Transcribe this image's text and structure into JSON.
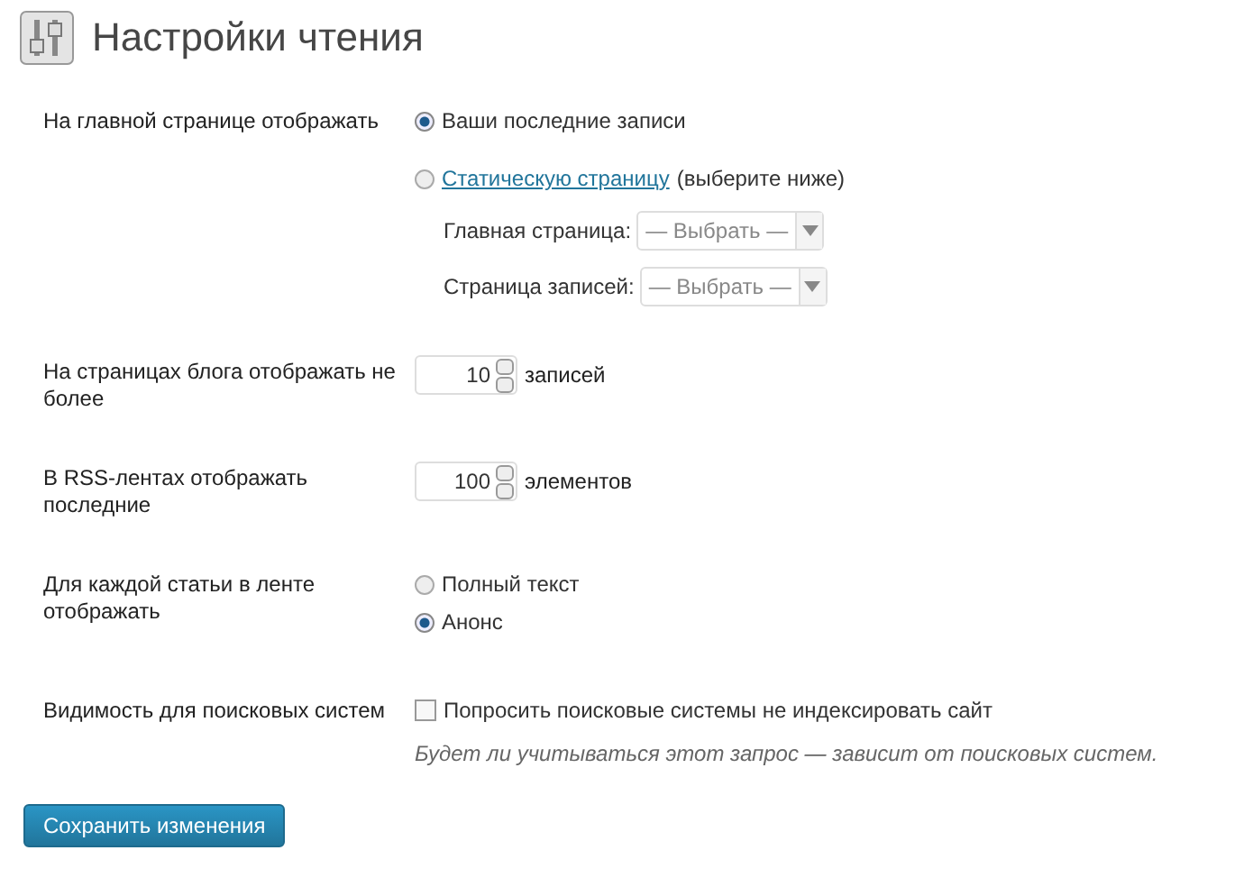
{
  "title": "Настройки чтения",
  "rows": [
    {
      "kind": "front",
      "label": "На главной странице отображать",
      "options": [
        {
          "label": "Ваши последние записи",
          "selected": true
        },
        {
          "link": "Статическую страницу",
          "label": "(выберите ниже)",
          "selected": false
        }
      ],
      "selects": [
        {
          "label": "Главная страница:",
          "value": "— Выбрать —"
        },
        {
          "label": "Страница записей:",
          "value": "— Выбрать —"
        }
      ]
    },
    {
      "kind": "number",
      "label": "На страницах блога отображать не более",
      "value": "10",
      "unit": "записей"
    },
    {
      "kind": "number",
      "label": "В RSS-лентах отображать последние",
      "value": "100",
      "unit": "элементов"
    },
    {
      "kind": "radio",
      "label": "Для каждой статьи в ленте отображать",
      "options": [
        {
          "label": "Полный текст",
          "selected": false
        },
        {
          "label": "Анонс",
          "selected": true
        }
      ]
    },
    {
      "kind": "checkbox",
      "label": "Видимость для поисковых систем",
      "checked": false,
      "text": "Попросить поисковые системы не индексировать сайт",
      "description": "Будет ли учитываться этот запрос — зависит от поисковых систем."
    }
  ],
  "save": "Сохранить изменения"
}
